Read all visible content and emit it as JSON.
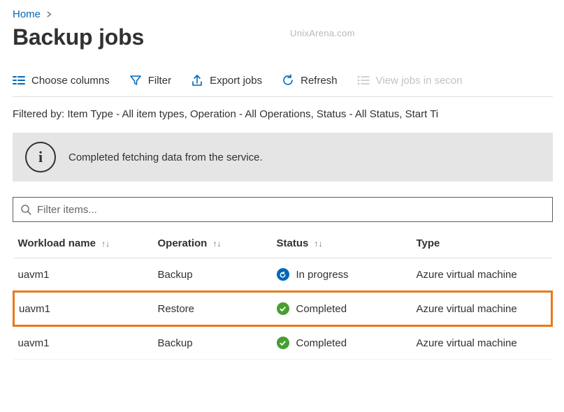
{
  "breadcrumb": {
    "home": "Home"
  },
  "title": "Backup jobs",
  "watermark": "UnixArena.com",
  "toolbar": {
    "choose_columns": "Choose columns",
    "filter": "Filter",
    "export": "Export jobs",
    "refresh": "Refresh",
    "view_secondary": "View jobs in secon"
  },
  "filter_summary": "Filtered by: Item Type - All item types, Operation - All Operations, Status - All Status, Start Ti",
  "banner": {
    "message": "Completed fetching data from the service."
  },
  "search": {
    "placeholder": "Filter items..."
  },
  "columns": {
    "workload": "Workload name",
    "operation": "Operation",
    "status": "Status",
    "type": "Type"
  },
  "rows": [
    {
      "workload": "uavm1",
      "operation": "Backup",
      "status": "In progress",
      "status_kind": "inprogress",
      "type": "Azure virtual machine",
      "highlight": false
    },
    {
      "workload": "uavm1",
      "operation": "Restore",
      "status": "Completed",
      "status_kind": "completed",
      "type": "Azure virtual machine",
      "highlight": true
    },
    {
      "workload": "uavm1",
      "operation": "Backup",
      "status": "Completed",
      "status_kind": "completed",
      "type": "Azure virtual machine",
      "highlight": false
    }
  ]
}
